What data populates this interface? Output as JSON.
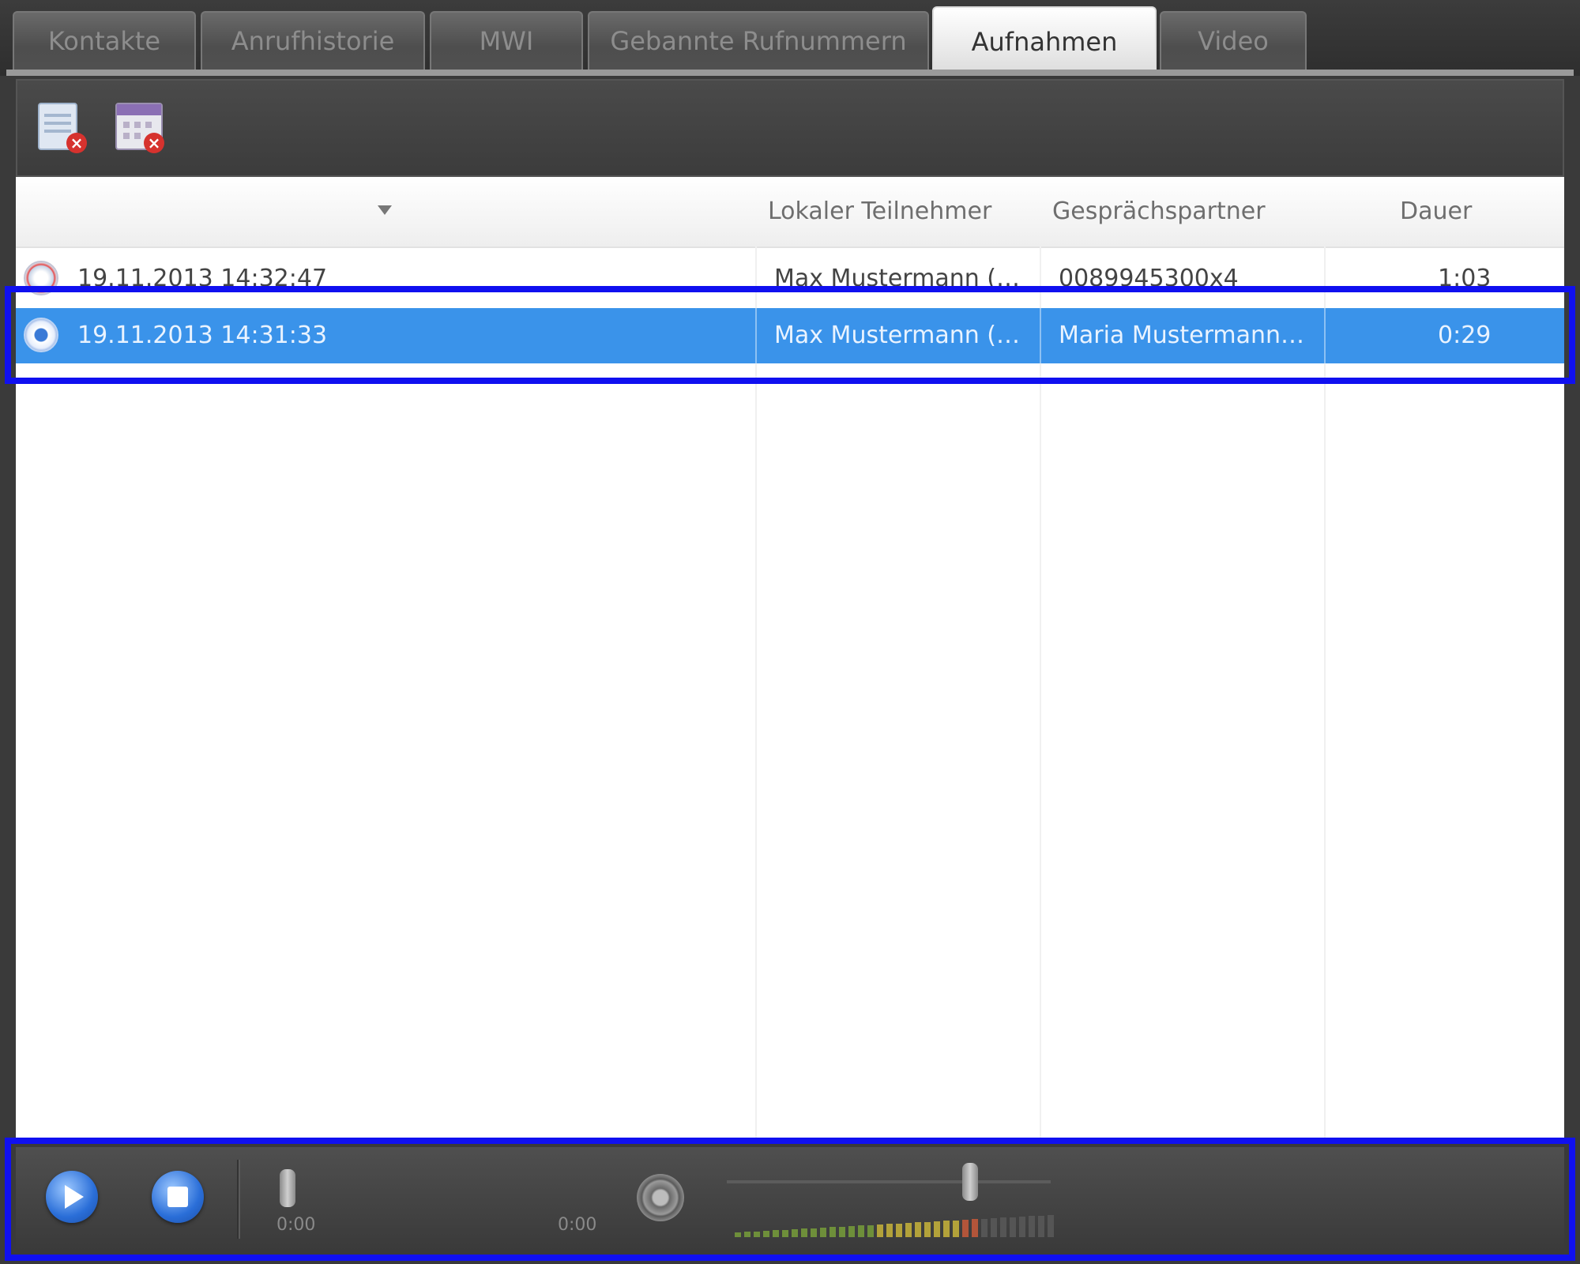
{
  "tabs": [
    "Kontakte",
    "Anrufhistorie",
    "MWI",
    "Gebannte Rufnummern",
    "Aufnahmen",
    "Video"
  ],
  "active_tab": "Aufnahmen",
  "toolbar": {
    "buttons": [
      {
        "name": "delete-recording",
        "icon": "document-delete-icon"
      },
      {
        "name": "delete-all-recordings",
        "icon": "calendar-delete-icon"
      }
    ]
  },
  "list": {
    "columns": [
      "",
      "Lokaler Teilnehmer",
      "Gesprächspartner",
      "Dauer"
    ],
    "sort_column": 0,
    "rows": [
      {
        "date": "19.11.2013 14:32:47",
        "local": "Max Mustermann (K...",
        "partner": "0089945300x4",
        "duration": "1:03",
        "selected": false
      },
      {
        "date": "19.11.2013 14:31:33",
        "local": "Max Mustermann (K...",
        "partner": "Maria Mustermann (...",
        "duration": "0:29",
        "selected": true
      }
    ]
  },
  "player": {
    "time_left": "0:00",
    "time_right": "0:00",
    "volume_level": 0.75,
    "selection_color": "#3a93ea",
    "highlight_color": "#1010f0"
  }
}
